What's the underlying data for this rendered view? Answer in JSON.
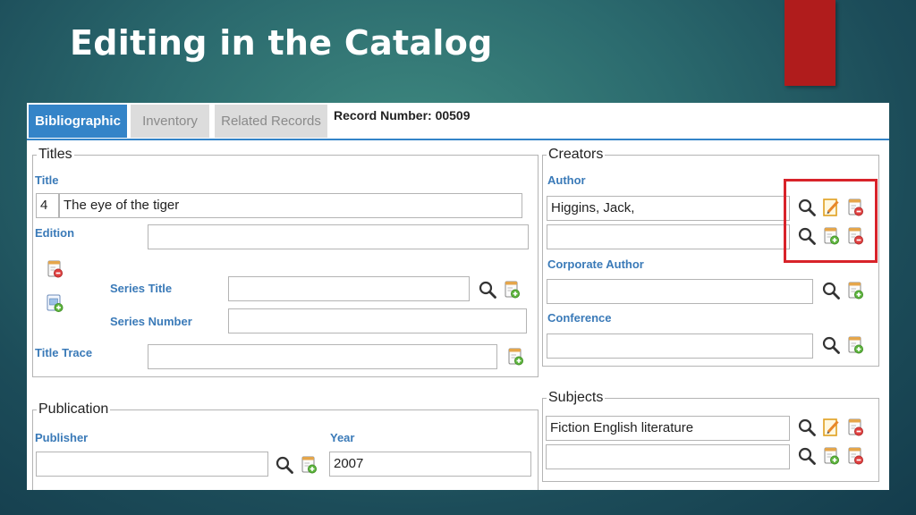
{
  "slide": {
    "title": "Editing in the Catalog",
    "accent_color": "#b01c1c"
  },
  "tabs": [
    {
      "label": "Bibliographic",
      "active": true
    },
    {
      "label": "Inventory",
      "active": false
    },
    {
      "label": "Related Records",
      "active": false
    }
  ],
  "record_number": "Record Number: 00509",
  "titles": {
    "legend": "Titles",
    "title_label": "Title",
    "title_prefix": "4",
    "title_value": "The eye of the tiger",
    "edition_label": "Edition",
    "edition_value": "",
    "series_title_label": "Series Title",
    "series_title_value": "",
    "series_number_label": "Series Number",
    "series_number_value": "",
    "title_trace_label": "Title Trace",
    "title_trace_value": ""
  },
  "publication": {
    "legend": "Publication",
    "publisher_label": "Publisher",
    "publisher_value": "",
    "year_label": "Year",
    "year_value": "2007"
  },
  "creators": {
    "legend": "Creators",
    "author_label": "Author",
    "author_values": [
      "Higgins, Jack,",
      ""
    ],
    "corporate_author_label": "Corporate Author",
    "corporate_author_value": "",
    "conference_label": "Conference",
    "conference_value": ""
  },
  "subjects": {
    "legend": "Subjects",
    "values": [
      "Fiction English literature",
      ""
    ]
  },
  "icons": {
    "search": "magnifier-icon",
    "add": "add-record-icon",
    "edit": "edit-record-icon",
    "remove": "remove-record-icon"
  },
  "highlight_color": "#d8232a"
}
